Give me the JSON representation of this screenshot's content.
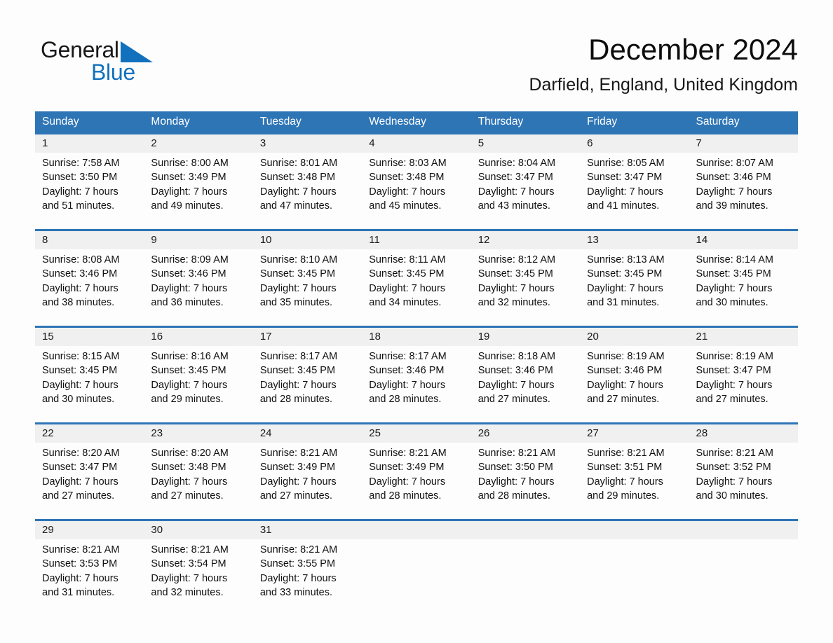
{
  "brand": {
    "word_general": "General",
    "word_blue": "Blue",
    "flag_icon": "triangle-flag-icon",
    "accent_color": "#1271bd"
  },
  "header": {
    "title": "December 2024",
    "location": "Darfield, England, United Kingdom"
  },
  "colors": {
    "header_blue": "#2e75b6",
    "daynum_band": "#f0f0f0",
    "page_background": "#fdfdfd"
  },
  "calendar": {
    "weekday_headers": [
      "Sunday",
      "Monday",
      "Tuesday",
      "Wednesday",
      "Thursday",
      "Friday",
      "Saturday"
    ],
    "weeks": [
      [
        {
          "day": "1",
          "l1": "Sunrise: 7:58 AM",
          "l2": "Sunset: 3:50 PM",
          "l3": "Daylight: 7 hours",
          "l4": "and 51 minutes."
        },
        {
          "day": "2",
          "l1": "Sunrise: 8:00 AM",
          "l2": "Sunset: 3:49 PM",
          "l3": "Daylight: 7 hours",
          "l4": "and 49 minutes."
        },
        {
          "day": "3",
          "l1": "Sunrise: 8:01 AM",
          "l2": "Sunset: 3:48 PM",
          "l3": "Daylight: 7 hours",
          "l4": "and 47 minutes."
        },
        {
          "day": "4",
          "l1": "Sunrise: 8:03 AM",
          "l2": "Sunset: 3:48 PM",
          "l3": "Daylight: 7 hours",
          "l4": "and 45 minutes."
        },
        {
          "day": "5",
          "l1": "Sunrise: 8:04 AM",
          "l2": "Sunset: 3:47 PM",
          "l3": "Daylight: 7 hours",
          "l4": "and 43 minutes."
        },
        {
          "day": "6",
          "l1": "Sunrise: 8:05 AM",
          "l2": "Sunset: 3:47 PM",
          "l3": "Daylight: 7 hours",
          "l4": "and 41 minutes."
        },
        {
          "day": "7",
          "l1": "Sunrise: 8:07 AM",
          "l2": "Sunset: 3:46 PM",
          "l3": "Daylight: 7 hours",
          "l4": "and 39 minutes."
        }
      ],
      [
        {
          "day": "8",
          "l1": "Sunrise: 8:08 AM",
          "l2": "Sunset: 3:46 PM",
          "l3": "Daylight: 7 hours",
          "l4": "and 38 minutes."
        },
        {
          "day": "9",
          "l1": "Sunrise: 8:09 AM",
          "l2": "Sunset: 3:46 PM",
          "l3": "Daylight: 7 hours",
          "l4": "and 36 minutes."
        },
        {
          "day": "10",
          "l1": "Sunrise: 8:10 AM",
          "l2": "Sunset: 3:45 PM",
          "l3": "Daylight: 7 hours",
          "l4": "and 35 minutes."
        },
        {
          "day": "11",
          "l1": "Sunrise: 8:11 AM",
          "l2": "Sunset: 3:45 PM",
          "l3": "Daylight: 7 hours",
          "l4": "and 34 minutes."
        },
        {
          "day": "12",
          "l1": "Sunrise: 8:12 AM",
          "l2": "Sunset: 3:45 PM",
          "l3": "Daylight: 7 hours",
          "l4": "and 32 minutes."
        },
        {
          "day": "13",
          "l1": "Sunrise: 8:13 AM",
          "l2": "Sunset: 3:45 PM",
          "l3": "Daylight: 7 hours",
          "l4": "and 31 minutes."
        },
        {
          "day": "14",
          "l1": "Sunrise: 8:14 AM",
          "l2": "Sunset: 3:45 PM",
          "l3": "Daylight: 7 hours",
          "l4": "and 30 minutes."
        }
      ],
      [
        {
          "day": "15",
          "l1": "Sunrise: 8:15 AM",
          "l2": "Sunset: 3:45 PM",
          "l3": "Daylight: 7 hours",
          "l4": "and 30 minutes."
        },
        {
          "day": "16",
          "l1": "Sunrise: 8:16 AM",
          "l2": "Sunset: 3:45 PM",
          "l3": "Daylight: 7 hours",
          "l4": "and 29 minutes."
        },
        {
          "day": "17",
          "l1": "Sunrise: 8:17 AM",
          "l2": "Sunset: 3:45 PM",
          "l3": "Daylight: 7 hours",
          "l4": "and 28 minutes."
        },
        {
          "day": "18",
          "l1": "Sunrise: 8:17 AM",
          "l2": "Sunset: 3:46 PM",
          "l3": "Daylight: 7 hours",
          "l4": "and 28 minutes."
        },
        {
          "day": "19",
          "l1": "Sunrise: 8:18 AM",
          "l2": "Sunset: 3:46 PM",
          "l3": "Daylight: 7 hours",
          "l4": "and 27 minutes."
        },
        {
          "day": "20",
          "l1": "Sunrise: 8:19 AM",
          "l2": "Sunset: 3:46 PM",
          "l3": "Daylight: 7 hours",
          "l4": "and 27 minutes."
        },
        {
          "day": "21",
          "l1": "Sunrise: 8:19 AM",
          "l2": "Sunset: 3:47 PM",
          "l3": "Daylight: 7 hours",
          "l4": "and 27 minutes."
        }
      ],
      [
        {
          "day": "22",
          "l1": "Sunrise: 8:20 AM",
          "l2": "Sunset: 3:47 PM",
          "l3": "Daylight: 7 hours",
          "l4": "and 27 minutes."
        },
        {
          "day": "23",
          "l1": "Sunrise: 8:20 AM",
          "l2": "Sunset: 3:48 PM",
          "l3": "Daylight: 7 hours",
          "l4": "and 27 minutes."
        },
        {
          "day": "24",
          "l1": "Sunrise: 8:21 AM",
          "l2": "Sunset: 3:49 PM",
          "l3": "Daylight: 7 hours",
          "l4": "and 27 minutes."
        },
        {
          "day": "25",
          "l1": "Sunrise: 8:21 AM",
          "l2": "Sunset: 3:49 PM",
          "l3": "Daylight: 7 hours",
          "l4": "and 28 minutes."
        },
        {
          "day": "26",
          "l1": "Sunrise: 8:21 AM",
          "l2": "Sunset: 3:50 PM",
          "l3": "Daylight: 7 hours",
          "l4": "and 28 minutes."
        },
        {
          "day": "27",
          "l1": "Sunrise: 8:21 AM",
          "l2": "Sunset: 3:51 PM",
          "l3": "Daylight: 7 hours",
          "l4": "and 29 minutes."
        },
        {
          "day": "28",
          "l1": "Sunrise: 8:21 AM",
          "l2": "Sunset: 3:52 PM",
          "l3": "Daylight: 7 hours",
          "l4": "and 30 minutes."
        }
      ],
      [
        {
          "day": "29",
          "l1": "Sunrise: 8:21 AM",
          "l2": "Sunset: 3:53 PM",
          "l3": "Daylight: 7 hours",
          "l4": "and 31 minutes."
        },
        {
          "day": "30",
          "l1": "Sunrise: 8:21 AM",
          "l2": "Sunset: 3:54 PM",
          "l3": "Daylight: 7 hours",
          "l4": "and 32 minutes."
        },
        {
          "day": "31",
          "l1": "Sunrise: 8:21 AM",
          "l2": "Sunset: 3:55 PM",
          "l3": "Daylight: 7 hours",
          "l4": "and 33 minutes."
        },
        {
          "day": "",
          "l1": "",
          "l2": "",
          "l3": "",
          "l4": ""
        },
        {
          "day": "",
          "l1": "",
          "l2": "",
          "l3": "",
          "l4": ""
        },
        {
          "day": "",
          "l1": "",
          "l2": "",
          "l3": "",
          "l4": ""
        },
        {
          "day": "",
          "l1": "",
          "l2": "",
          "l3": "",
          "l4": ""
        }
      ]
    ]
  }
}
